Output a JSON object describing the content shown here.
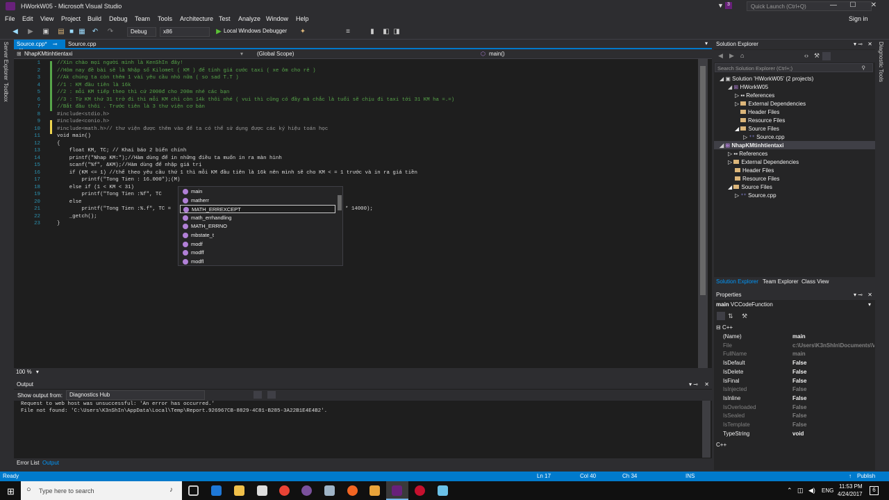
{
  "window": {
    "title": "HWorkW05 - Microsoft Visual Studio",
    "quick_launch": "Quick Launch (Ctrl+Q)",
    "sign_in": "Sign in",
    "notif_count": "3"
  },
  "menu": [
    "File",
    "Edit",
    "View",
    "Project",
    "Build",
    "Debug",
    "Team",
    "Tools",
    "Architecture",
    "Test",
    "Analyze",
    "Window",
    "Help"
  ],
  "toolbar": {
    "config": "Debug",
    "platform": "x86",
    "run_label": "Local Windows Debugger"
  },
  "left_tabs": [
    "Server Explorer",
    "Toolbox"
  ],
  "tabs": [
    {
      "label": "Source.cpp*",
      "active": true
    },
    {
      "label": "Source.cpp",
      "active": false
    }
  ],
  "nav": {
    "project": "NhapKMtinhtientaxi",
    "scope": "(Global Scope)",
    "func": "main()"
  },
  "code": [
    {
      "n": "1",
      "t": "//Xin chào mọi người mình là KenShIn đây!",
      "c": "cm"
    },
    {
      "n": "2",
      "t": "//Hôm nay đề bài sẽ là Nhập số Kilomet ( KM ) để tính giá cước taxi ( xe ôm cho rẻ )",
      "c": "cm"
    },
    {
      "n": "3",
      "t": "//Ak chúng ta còn thêm 1 vài yêu cầu nhỏ nữa ( so sad T.T )",
      "c": "cm"
    },
    {
      "n": "4",
      "t": "//1 : KM đầu tiên là 16k",
      "c": "cm"
    },
    {
      "n": "5",
      "t": "//2 : mỗi KM tiếp theo thì cứ 2000đ cho 200m nhé các bạn",
      "c": "cm"
    },
    {
      "n": "6",
      "t": "//3 : Từ KM thứ 31 trở đi thì mỗi KM chỉ còn 14k thôi nhé ( vui thì cũng có đầy mà chắc là tuổi sẽ chịu đi taxi tới 31 KM ha =.=)",
      "c": "cm"
    },
    {
      "n": "7",
      "t": "//Bắt đầu thôi . Trước tiên là 3 thư viện cơ bản",
      "c": "cm"
    },
    {
      "n": "8",
      "t": "#include<stdio.h>",
      "c": "pp"
    },
    {
      "n": "9",
      "t": "#include<conio.h>",
      "c": "pp"
    },
    {
      "n": "10",
      "t": "#include<math.h>// thư viện được thêm vào để ta có thể sử dụng được các ký hiệu toán học",
      "c": "pp"
    },
    {
      "n": "11",
      "t": "void main()",
      "c": ""
    },
    {
      "n": "12",
      "t": "{",
      "c": ""
    },
    {
      "n": "13",
      "t": "    float KM, TC; // Khai báo 2 biến chính",
      "c": ""
    },
    {
      "n": "14",
      "t": "    printf(\"Nhap KM:\");//Hàm dùng để in những điều ta muốn in ra màn hình",
      "c": ""
    },
    {
      "n": "15",
      "t": "    scanf(\"%f\", &KM);//Hàm dùng để nhập giá trị",
      "c": ""
    },
    {
      "n": "16",
      "t": "    if (KM <= 1) //thế theo yêu cầu thứ 1 thì mỗi KM đầu tiên là 16k nên mình sẽ cho KM < = 1 trước và in ra giá tiền",
      "c": ""
    },
    {
      "n": "17",
      "t": "        printf(\"Tong Tien : 16.000\");(M)",
      "c": ""
    },
    {
      "n": "18",
      "t": "    else if (1 < KM < 31)",
      "c": ""
    },
    {
      "n": "19",
      "t": "        printf(\"Tong Tien :%f\", TC",
      "c": ""
    },
    {
      "n": "20",
      "t": "    else",
      "c": ""
    },
    {
      "n": "21",
      "t": "        printf(\"Tong Tien :%.f\", TC =",
      "c": ""
    },
    {
      "n": "22",
      "t": "    _getch();",
      "c": ""
    },
    {
      "n": "23",
      "t": "}",
      "c": ""
    }
  ],
  "code_line21_tail": "* 14000);",
  "intellisense": [
    "main",
    "matherr",
    "MATH_ERREXCEPT",
    "math_errhandling",
    "MATH_ERRNO",
    "mbstate_t",
    "modf",
    "modff",
    "modfl"
  ],
  "zoom": "100 %",
  "output": {
    "title": "Output",
    "show_from_label": "Show output from:",
    "source": "Diagnostics Hub",
    "lines": [
      "Request to web host was unsuccessful: 'An error has occurred.'",
      "File not found: 'C:\\Users\\K3nShIn\\AppData\\Local\\Temp\\Report.926967CB-8829-4C81-B285-3A22B1E4E4B2'."
    ]
  },
  "bottom_tabs": [
    "Error List",
    "Output"
  ],
  "solution": {
    "title": "Solution Explorer",
    "search": "Search Solution Explorer (Ctrl+;)",
    "root": "Solution 'HWorkW05' (2 projects)",
    "proj1": "HWorkW05",
    "proj2": "NhapKMtinhtientaxi",
    "items": [
      "References",
      "External Dependencies",
      "Header Files",
      "Resource Files",
      "Source Files"
    ],
    "file": "Source.cpp",
    "tabs": [
      "Solution Explorer",
      "Team Explorer",
      "Class View"
    ]
  },
  "properties": {
    "title": "Properties",
    "object": "main",
    "type": "VCCodeFunction",
    "category": "C++",
    "rows": [
      {
        "k": "(Name)",
        "v": "main",
        "dim": false
      },
      {
        "k": "File",
        "v": "c:\\Users\\K3nShIn\\Documents\\V",
        "dim": true
      },
      {
        "k": "FullName",
        "v": "main",
        "dim": true
      },
      {
        "k": "IsDefault",
        "v": "False",
        "dim": false
      },
      {
        "k": "IsDelete",
        "v": "False",
        "dim": false
      },
      {
        "k": "IsFinal",
        "v": "False",
        "dim": false
      },
      {
        "k": "IsInjected",
        "v": "False",
        "dim": true
      },
      {
        "k": "IsInline",
        "v": "False",
        "dim": false
      },
      {
        "k": "IsOverloaded",
        "v": "False",
        "dim": true
      },
      {
        "k": "IsSealed",
        "v": "False",
        "dim": true
      },
      {
        "k": "IsTemplate",
        "v": "False",
        "dim": true
      },
      {
        "k": "TypeString",
        "v": "void",
        "dim": false
      }
    ],
    "footer": "C++"
  },
  "right_tabs": [
    "Diagnostic Tools"
  ],
  "status": {
    "ready": "Ready",
    "ln": "Ln 17",
    "col": "Col 40",
    "ch": "Ch 34",
    "ins": "INS",
    "publish": "Publish"
  },
  "taskbar": {
    "search": "Type here to search",
    "lang": "ENG",
    "time": "11:53 PM",
    "date": "4/24/2017",
    "notif": "6"
  }
}
